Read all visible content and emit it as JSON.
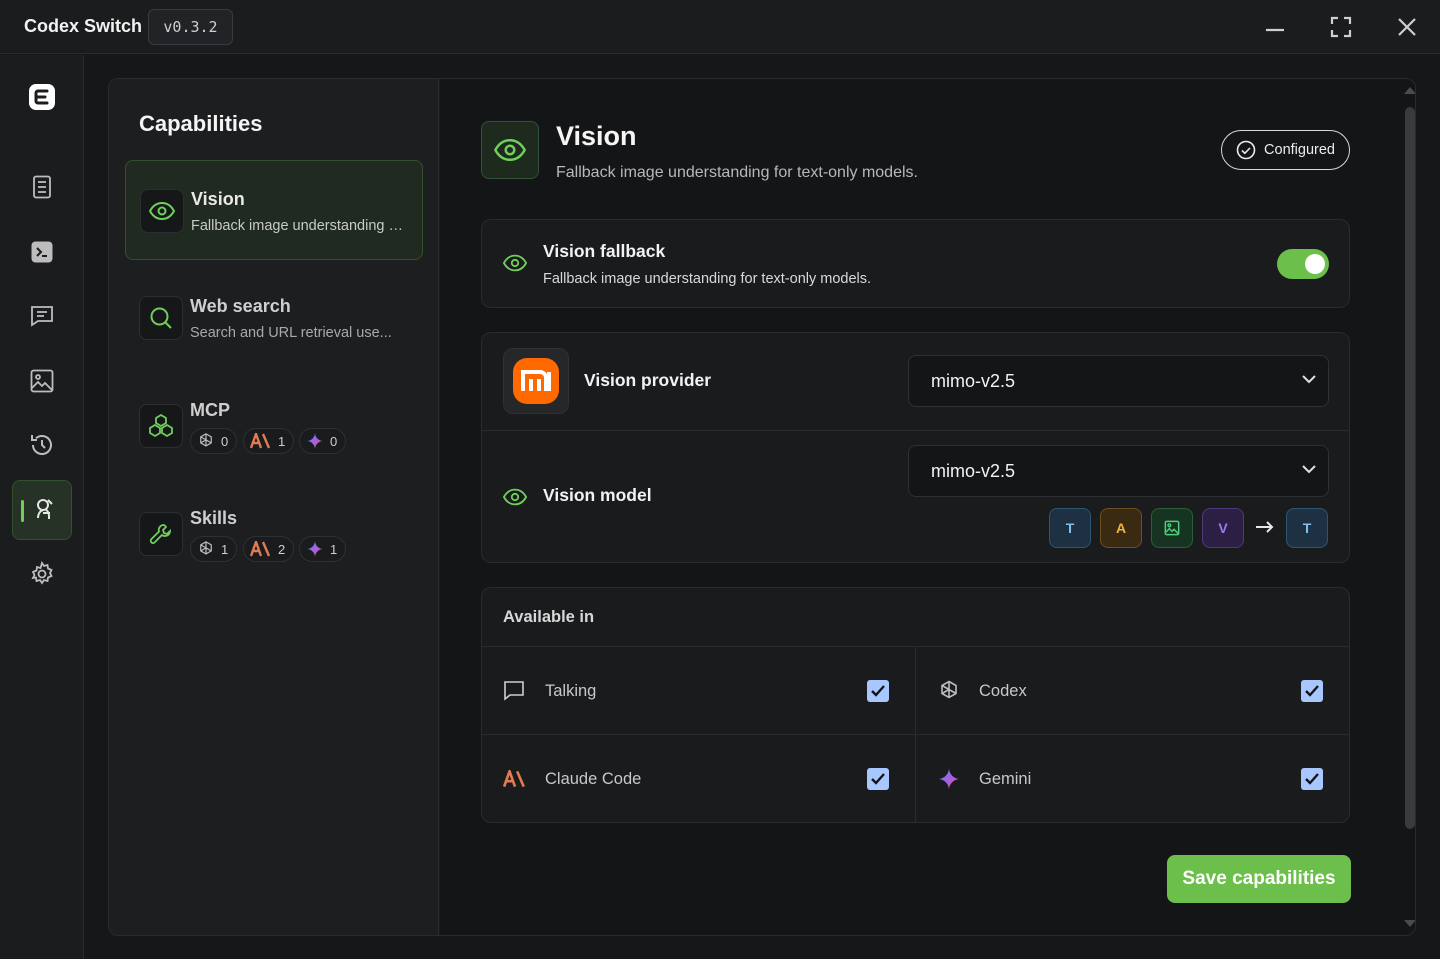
{
  "window": {
    "title": "Codex Switch",
    "version": "v0.3.2"
  },
  "rail": {
    "items": [
      "logo-icon",
      "document-icon",
      "terminal-icon",
      "chat-icon",
      "image-icon",
      "history-icon",
      "capabilities-icon",
      "settings-icon"
    ],
    "active": "capabilities-icon"
  },
  "capabilities": {
    "heading": "Capabilities",
    "items": [
      {
        "title": "Vision",
        "desc": "Fallback image understanding for text-only models."
      },
      {
        "title": "Web search",
        "desc": "Search and URL retrieval use..."
      },
      {
        "title": "MCP",
        "counts": {
          "codex": "0",
          "claude": "1",
          "gemini": "0"
        }
      },
      {
        "title": "Skills",
        "counts": {
          "codex": "1",
          "claude": "2",
          "gemini": "1"
        }
      }
    ]
  },
  "detail": {
    "title": "Vision",
    "desc": "Fallback image understanding for text-only models.",
    "badge": "Configured",
    "fallback": {
      "title": "Vision fallback",
      "desc": "Fallback image understanding for text-only models.",
      "enabled": true
    },
    "provider": {
      "label": "Vision provider",
      "value": "mimo-v2.5"
    },
    "model": {
      "label": "Vision model",
      "value": "mimo-v2.5",
      "input_caps": [
        "T",
        "A",
        "image",
        "V"
      ],
      "output_caps": [
        "T"
      ]
    },
    "available": {
      "heading": "Available in",
      "targets": [
        {
          "label": "Talking",
          "checked": true
        },
        {
          "label": "Codex",
          "checked": true
        },
        {
          "label": "Claude Code",
          "checked": true
        },
        {
          "label": "Gemini",
          "checked": true
        }
      ]
    },
    "save_label": "Save capabilities"
  },
  "colors": {
    "accent": "#6bbf4a",
    "claude": "#e07b53",
    "checkbox": "#a9c7ff",
    "mi_orange": "#ff6900"
  }
}
